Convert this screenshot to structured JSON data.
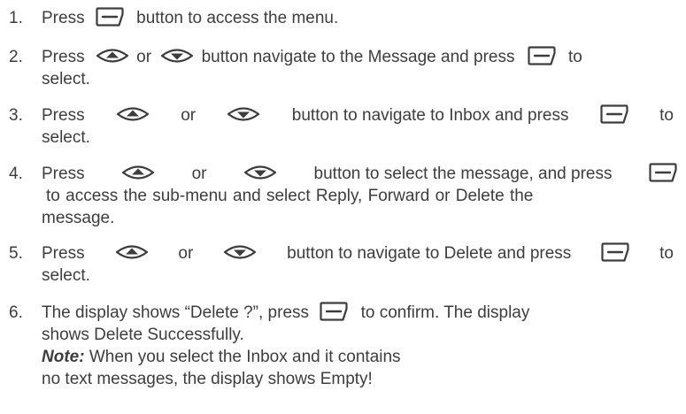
{
  "icons": {
    "menu_key": "menu-softkey-icon",
    "up_key": "up-arrow-key-icon",
    "down_key": "down-arrow-key-icon"
  },
  "steps": [
    {
      "number": "1.",
      "lines": [
        [
          "Press",
          "button to access the menu."
        ]
      ]
    },
    {
      "number": "2.",
      "lines": [
        [
          "Press",
          "or",
          "button navigate to the Message and press",
          "to"
        ],
        [
          "select."
        ]
      ]
    },
    {
      "number": "3.",
      "lines": [
        [
          "Press",
          "or",
          "button to navigate to Inbox and press",
          "to"
        ],
        [
          "select."
        ]
      ]
    },
    {
      "number": "4.",
      "lines": [
        [
          "Press",
          "or",
          "button to select the message, and press"
        ],
        [
          "to access the sub-menu and select Reply, Forward or Delete the"
        ],
        [
          "message."
        ]
      ]
    },
    {
      "number": "5.",
      "lines": [
        [
          "Press",
          "or",
          "button to navigate to Delete and press",
          "to"
        ],
        [
          "select."
        ]
      ]
    },
    {
      "number": "6.",
      "lines": [
        [
          "The display shows “Delete ?”, press",
          "to confirm. The display"
        ],
        [
          "shows Delete Successfully."
        ],
        [
          "When you select the Inbox and it contains"
        ],
        [
          "no text messages, the display shows Empty!"
        ]
      ],
      "note_label": "Note:"
    }
  ]
}
